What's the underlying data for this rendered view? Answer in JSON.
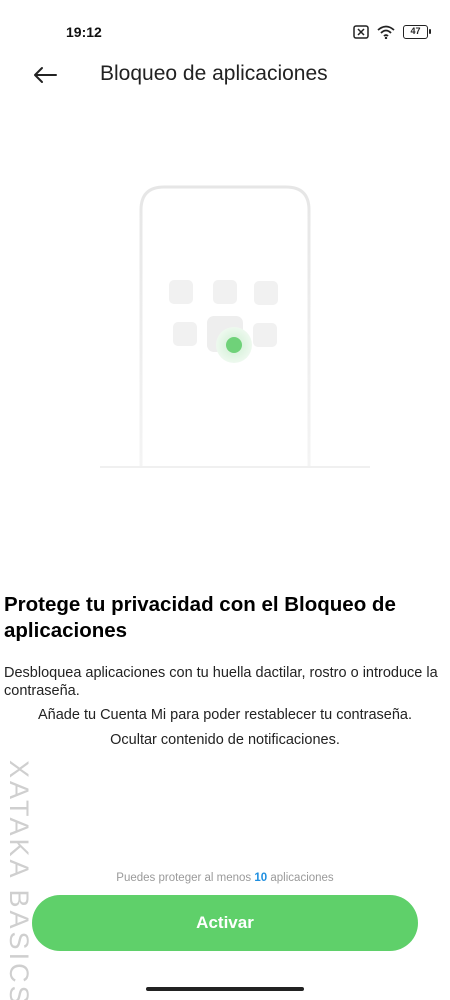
{
  "status_bar": {
    "time": "19:12",
    "battery_level": "47",
    "icons": [
      "no-sim-icon",
      "wifi-icon",
      "battery-icon"
    ]
  },
  "app_bar": {
    "back_icon": "arrow-left-icon",
    "title": "Bloqueo de aplicaciones"
  },
  "content": {
    "headline": "Protege tu privacidad con el Bloqueo de aplicaciones",
    "description": "Desbloquea aplicaciones con tu huella dactilar, rostro o introduce la contraseña.",
    "line_account": "Añade tu Cuenta Mi para poder restablecer tu contraseña.",
    "line_notifications": "Ocultar contenido de notificaciones."
  },
  "footer": {
    "hint_prefix": "Puedes proteger al menos",
    "hint_count": "10",
    "hint_suffix": "aplicaciones",
    "activate_label": "Activar"
  },
  "watermark": {
    "text": "XATAKA BASICS"
  },
  "colors": {
    "accent_green": "#5fd06a",
    "link_blue": "#1f8fe0"
  }
}
